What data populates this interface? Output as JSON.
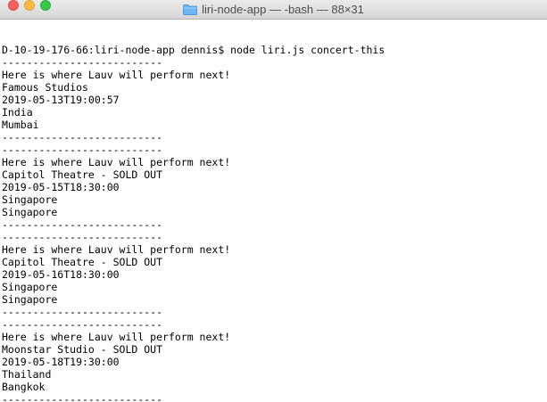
{
  "window": {
    "title": "liri-node-app — -bash — 88×31",
    "folder_icon": "folder-icon",
    "colors": {
      "close": "#fc605c",
      "minimize": "#fdbc40",
      "maximize": "#34c84a",
      "folder": "#6cb6f2"
    }
  },
  "terminal": {
    "lines": [
      "",
      "",
      "D-10-19-176-66:liri-node-app dennis$ node liri.js concert-this",
      "--------------------------",
      "Here is where Lauv will perform next!",
      "Famous Studios",
      "2019-05-13T19:00:57",
      "India",
      "Mumbai",
      "--------------------------",
      "--------------------------",
      "Here is where Lauv will perform next!",
      "Capitol Theatre - SOLD OUT",
      "2019-05-15T18:30:00",
      "Singapore",
      "Singapore",
      "--------------------------",
      "--------------------------",
      "Here is where Lauv will perform next!",
      "Capitol Theatre - SOLD OUT",
      "2019-05-16T18:30:00",
      "Singapore",
      "Singapore",
      "--------------------------",
      "--------------------------",
      "Here is where Lauv will perform next!",
      "Moonstar Studio - SOLD OUT",
      "2019-05-18T19:30:00",
      "Thailand",
      "Bangkok",
      "--------------------------"
    ]
  }
}
